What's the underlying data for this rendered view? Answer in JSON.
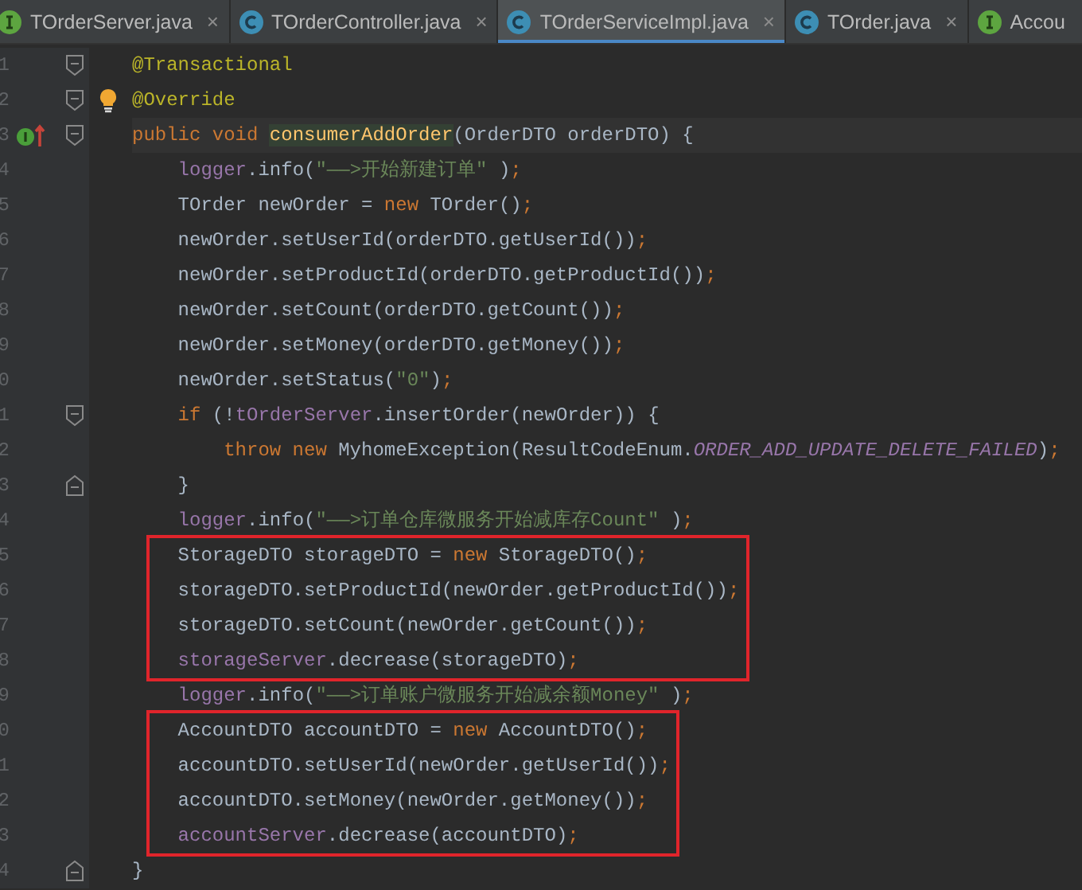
{
  "tabs": [
    {
      "label": "TOrderServer.java",
      "kind": "interface",
      "close": "×",
      "selected": false
    },
    {
      "label": "TOrderController.java",
      "kind": "class",
      "close": "×",
      "selected": false
    },
    {
      "label": "TOrderServiceImpl.java",
      "kind": "class",
      "close": "×",
      "selected": true
    },
    {
      "label": "TOrder.java",
      "kind": "class",
      "close": "×",
      "selected": false
    },
    {
      "label": "Accou",
      "kind": "interface",
      "selected": false
    }
  ],
  "lines": [
    {
      "number": "1",
      "gutter": [
        {
          "kind": "fold-start"
        }
      ],
      "current": false,
      "tokens": [
        {
          "t": "@Transactional",
          "kind": "annotation"
        }
      ]
    },
    {
      "number": "2",
      "gutter": [
        {
          "kind": "fold-start"
        },
        {
          "kind": "bulb"
        }
      ],
      "current": false,
      "tokens": [
        {
          "t": "@Override",
          "kind": "annotation"
        }
      ]
    },
    {
      "number": "3",
      "gutter": [
        {
          "kind": "implements"
        },
        {
          "kind": "fold-start"
        }
      ],
      "current": true,
      "tokens": [
        {
          "t": "public void ",
          "kind": "keyword"
        },
        {
          "t": "consumerAddOrder",
          "kind": "decl"
        },
        {
          "t": "(OrderDTO orderDTO) {",
          "kind": "plain"
        }
      ],
      "children": [
        {
          "number": "4",
          "current": false,
          "tokens": [
            {
              "t": "logger",
              "kind": "field"
            },
            {
              "t": ".info(",
              "kind": "plain"
            },
            {
              "t": "\"——>开始新建订单\"",
              "kind": "string"
            },
            {
              "t": " )",
              "kind": "plain"
            },
            {
              "t": ";",
              "kind": "semi"
            }
          ]
        },
        {
          "number": "5",
          "current": false,
          "tokens": [
            {
              "t": "TOrder newOrder = ",
              "kind": "plain"
            },
            {
              "t": "new",
              "kind": "keyword"
            },
            {
              "t": " TOrder()",
              "kind": "plain"
            },
            {
              "t": ";",
              "kind": "semi"
            }
          ]
        },
        {
          "number": "6",
          "current": false,
          "tokens": [
            {
              "t": "newOrder.setUserId(orderDTO.getUserId())",
              "kind": "plain"
            },
            {
              "t": ";",
              "kind": "semi"
            }
          ]
        },
        {
          "number": "7",
          "current": false,
          "tokens": [
            {
              "t": "newOrder.setProductId(orderDTO.getProductId())",
              "kind": "plain"
            },
            {
              "t": ";",
              "kind": "semi"
            }
          ]
        },
        {
          "number": "8",
          "current": false,
          "tokens": [
            {
              "t": "newOrder.setCount(orderDTO.getCount())",
              "kind": "plain"
            },
            {
              "t": ";",
              "kind": "semi"
            }
          ]
        },
        {
          "number": "9",
          "current": false,
          "tokens": [
            {
              "t": "newOrder.setMoney(orderDTO.getMoney())",
              "kind": "plain"
            },
            {
              "t": ";",
              "kind": "semi"
            }
          ]
        },
        {
          "number": "0",
          "current": false,
          "tokens": [
            {
              "t": "newOrder.setStatus(",
              "kind": "plain"
            },
            {
              "t": "\"0\"",
              "kind": "string"
            },
            {
              "t": ")",
              "kind": "plain"
            },
            {
              "t": ";",
              "kind": "semi"
            }
          ]
        },
        {
          "number": "1",
          "gutter": [
            {
              "kind": "fold-start"
            }
          ],
          "current": false,
          "tokens": [
            {
              "t": "if",
              "kind": "keyword"
            },
            {
              "t": " (!",
              "kind": "plain"
            },
            {
              "t": "tOrderServer",
              "kind": "field"
            },
            {
              "t": ".insertOrder(newOrder)) {",
              "kind": "plain"
            }
          ],
          "children": [
            {
              "number": "2",
              "current": false,
              "tokens": [
                {
                  "t": "throw new",
                  "kind": "keyword"
                },
                {
                  "t": " MyhomeException(ResultCodeEnum.",
                  "kind": "plain"
                },
                {
                  "t": "ORDER_ADD_UPDATE_DELETE_FAILED",
                  "kind": "constant"
                },
                {
                  "t": ")",
                  "kind": "plain"
                },
                {
                  "t": ";",
                  "kind": "semi"
                }
              ]
            }
          ]
        },
        {
          "number": "3",
          "gutter": [
            {
              "kind": "fold-end"
            }
          ],
          "current": false,
          "tokens": [
            {
              "t": "}",
              "kind": "plain"
            }
          ]
        },
        {
          "number": "4",
          "current": false,
          "tokens": [
            {
              "t": "logger",
              "kind": "field"
            },
            {
              "t": ".info(",
              "kind": "plain"
            },
            {
              "t": "\"——>订单仓库微服务开始减库存Count\"",
              "kind": "string"
            },
            {
              "t": " )",
              "kind": "plain"
            },
            {
              "t": ";",
              "kind": "semi"
            }
          ]
        },
        {
          "kind": "red-frame",
          "lines": [
            {
              "number": "5",
              "current": false,
              "tokens": [
                {
                  "t": "StorageDTO storageDTO = ",
                  "kind": "plain"
                },
                {
                  "t": "new",
                  "kind": "keyword"
                },
                {
                  "t": " StorageDTO()",
                  "kind": "plain"
                },
                {
                  "t": ";",
                  "kind": "semi"
                }
              ]
            },
            {
              "number": "6",
              "current": false,
              "tokens": [
                {
                  "t": "storageDTO.setProductId(newOrder.getProductId())",
                  "kind": "plain"
                },
                {
                  "t": ";",
                  "kind": "semi"
                }
              ]
            },
            {
              "number": "7",
              "current": false,
              "tokens": [
                {
                  "t": "storageDTO.setCount(newOrder.getCount())",
                  "kind": "plain"
                },
                {
                  "t": ";",
                  "kind": "semi"
                }
              ]
            },
            {
              "number": "8",
              "current": false,
              "tokens": [
                {
                  "t": "storageServer",
                  "kind": "field"
                },
                {
                  "t": ".decrease(storageDTO)",
                  "kind": "plain"
                },
                {
                  "t": ";",
                  "kind": "semi"
                }
              ]
            }
          ]
        },
        {
          "number": "9",
          "current": false,
          "tokens": [
            {
              "t": "logger",
              "kind": "field"
            },
            {
              "t": ".info(",
              "kind": "plain"
            },
            {
              "t": "\"——>订单账户微服务开始减余额Money\"",
              "kind": "string"
            },
            {
              "t": " )",
              "kind": "plain"
            },
            {
              "t": ";",
              "kind": "semi"
            }
          ]
        },
        {
          "kind": "red-frame",
          "lines": [
            {
              "number": "0",
              "current": false,
              "tokens": [
                {
                  "t": "AccountDTO accountDTO = ",
                  "kind": "plain"
                },
                {
                  "t": "new",
                  "kind": "keyword"
                },
                {
                  "t": " AccountDTO()",
                  "kind": "plain"
                },
                {
                  "t": ";",
                  "kind": "semi"
                }
              ]
            },
            {
              "number": "1",
              "current": false,
              "tokens": [
                {
                  "t": "accountDTO.setUserId(newOrder.getUserId())",
                  "kind": "plain"
                },
                {
                  "t": ";",
                  "kind": "semi"
                }
              ]
            },
            {
              "number": "2",
              "current": false,
              "tokens": [
                {
                  "t": "accountDTO.setMoney(newOrder.getMoney())",
                  "kind": "plain"
                },
                {
                  "t": ";",
                  "kind": "semi"
                }
              ]
            },
            {
              "number": "3",
              "current": false,
              "tokens": [
                {
                  "t": "accountServer",
                  "kind": "field"
                },
                {
                  "t": ".decrease(accountDTO)",
                  "kind": "plain"
                },
                {
                  "t": ";",
                  "kind": "semi"
                }
              ]
            }
          ]
        }
      ]
    },
    {
      "number": "4",
      "gutter": [
        {
          "kind": "fold-end"
        }
      ],
      "current": false,
      "tokens": [
        {
          "t": "}",
          "kind": "plain"
        }
      ]
    }
  ]
}
